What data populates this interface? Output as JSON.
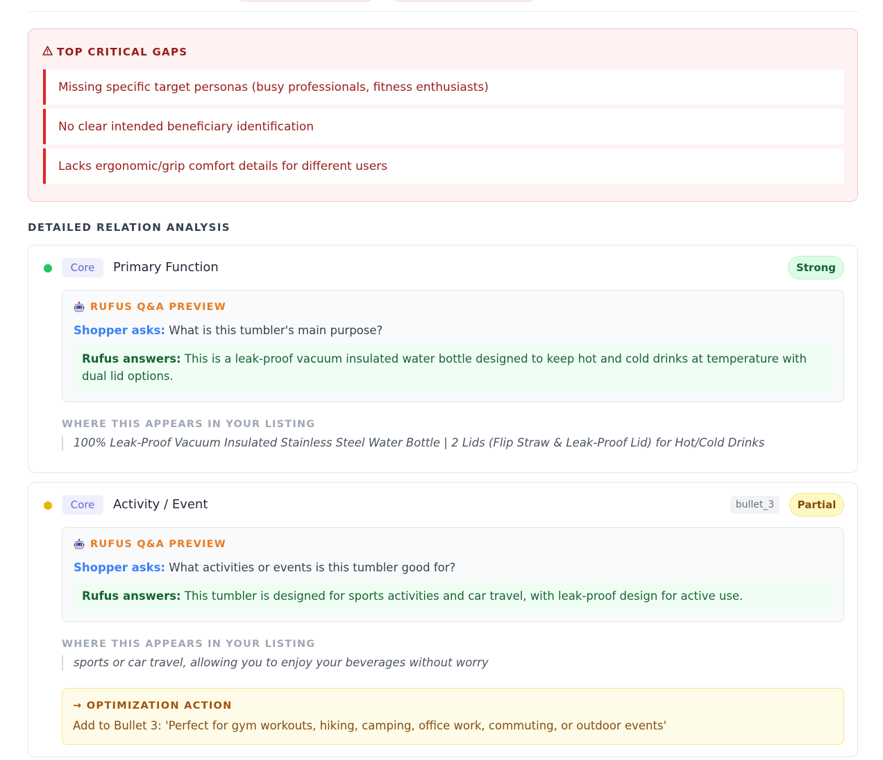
{
  "critical_gaps": {
    "icon": "warning-icon",
    "title": "TOP CRITICAL GAPS",
    "items": [
      "Missing specific target personas (busy professionals, fitness enthusiasts)",
      "No clear intended beneficiary identification",
      "Lacks ergonomic/grip comfort details for different users"
    ]
  },
  "analysis": {
    "title": "DETAILED RELATION ANALYSIS",
    "cards": [
      {
        "dot_color": "#22c55e",
        "category": "Core",
        "name": "Primary Function",
        "status": "Strong",
        "qa_icon": "robot-icon",
        "qa_title": "RUFUS Q&A PREVIEW",
        "shopper_label": "Shopper asks:",
        "question": "What is this tumbler's main purpose?",
        "rufus_label": "Rufus answers:",
        "answer": "This is a leak-proof vacuum insulated water bottle designed to keep hot and cold drinks at temperature with dual lid options.",
        "where_label": "WHERE THIS APPEARS IN YOUR LISTING",
        "where_quote": "100% Leak-Proof Vacuum Insulated Stainless Steel Water Bottle | 2 Lids (Flip Straw & Leak-Proof Lid) for Hot/Cold Drinks"
      },
      {
        "dot_color": "#eab308",
        "category": "Core",
        "name": "Activity / Event",
        "source_tag": "bullet_3",
        "status": "Partial",
        "qa_icon": "robot-icon",
        "qa_title": "RUFUS Q&A PREVIEW",
        "shopper_label": "Shopper asks:",
        "question": "What activities or events is this tumbler good for?",
        "rufus_label": "Rufus answers:",
        "answer": "This tumbler is designed for sports activities and car travel, with leak-proof design for active use.",
        "where_label": "WHERE THIS APPEARS IN YOUR LISTING",
        "where_quote": "sports or car travel, allowing you to enjoy your beverages without worry",
        "optimization_title": "→ OPTIMIZATION ACTION",
        "optimization_text": "Add to Bullet 3: 'Perfect for gym workouts, hiking, camping, office work, commuting, or outdoor events'"
      }
    ]
  }
}
